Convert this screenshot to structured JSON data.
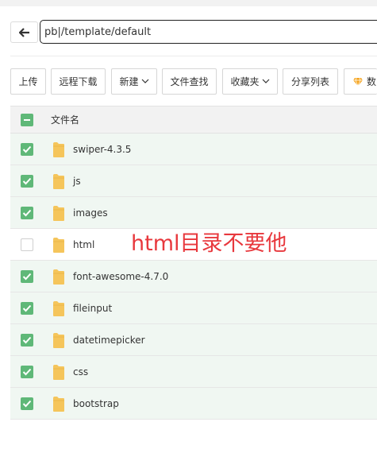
{
  "path_bar": {
    "value": "pb|/template/default"
  },
  "toolbar": {
    "buttons": [
      {
        "label": "上传"
      },
      {
        "label": "远程下载"
      },
      {
        "label": "新建"
      },
      {
        "label": "文件查找"
      },
      {
        "label": "收藏夹"
      },
      {
        "label": "分享列表"
      },
      {
        "label": "数"
      }
    ]
  },
  "table": {
    "header": {
      "name_col": "文件名"
    },
    "rows": [
      {
        "name": "swiper-4.3.5",
        "checked": true
      },
      {
        "name": "js",
        "checked": true
      },
      {
        "name": "images",
        "checked": true
      },
      {
        "name": "html",
        "checked": false
      },
      {
        "name": "font-awesome-4.7.0",
        "checked": true
      },
      {
        "name": "fileinput",
        "checked": true
      },
      {
        "name": "datetimepicker",
        "checked": true
      },
      {
        "name": "css",
        "checked": true
      },
      {
        "name": "bootstrap",
        "checked": true
      }
    ]
  },
  "annotation": "html目录不要他",
  "colors": {
    "check_green": "#5fb878",
    "checked_row_bg": "#f0f7f2",
    "folder_yellow": "#f5c55b",
    "annotation_red": "#e8383d",
    "gem_orange": "#f5a623"
  },
  "icons": {
    "back": "arrow-left-icon",
    "folder": "folder-icon",
    "chevron": "chevron-down-icon",
    "gem": "diamond-icon",
    "check": "checkmark-icon"
  }
}
